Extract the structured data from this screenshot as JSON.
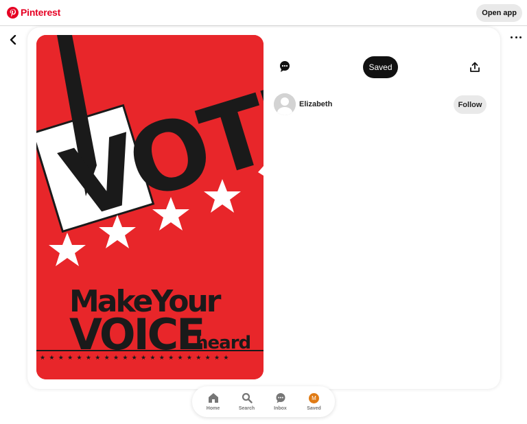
{
  "header": {
    "brand_name": "Pinterest",
    "brand_color": "#e60023",
    "open_app_label": "Open app"
  },
  "navigation": {
    "back_icon": "chevron-left-icon",
    "more_icon": "ellipsis-icon"
  },
  "pin": {
    "image": {
      "line1": "VOTE",
      "line2": "MakeYour",
      "line3": "VOICE",
      "line4": "heard",
      "background_color": "#e8262a"
    },
    "actions": {
      "comment_icon": "comment-bubble-icon",
      "saved_label": "Saved",
      "share_icon": "share-upload-icon"
    },
    "author": {
      "name": "Elizabeth",
      "follow_label": "Follow"
    }
  },
  "bottom_nav": {
    "items": [
      {
        "label": "Home",
        "icon": "home-icon"
      },
      {
        "label": "Search",
        "icon": "search-icon"
      },
      {
        "label": "Inbox",
        "icon": "chat-bubble-icon"
      },
      {
        "label": "Saved",
        "icon": "avatar-icon",
        "avatar_letter": "M"
      }
    ]
  }
}
